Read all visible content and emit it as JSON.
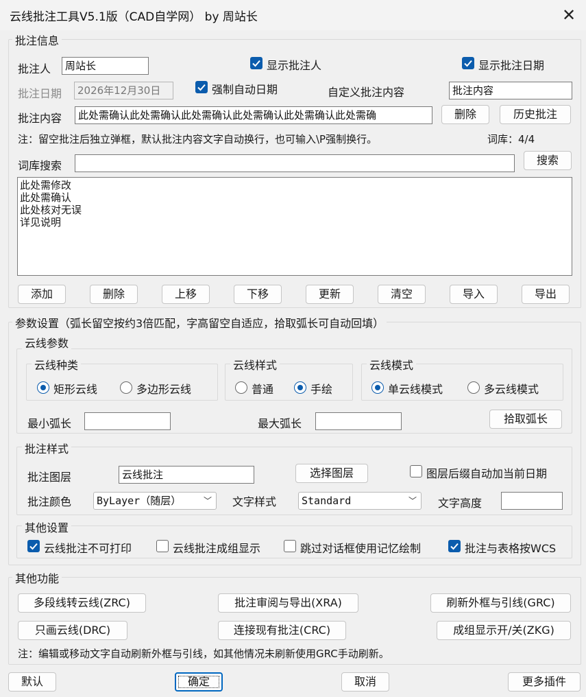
{
  "window": {
    "title": "云线批注工具V5.1版（CAD自学网） by 周站长",
    "close_glyph": "✕"
  },
  "annotation_info": {
    "legend": "批注信息",
    "annotator_label": "批注人",
    "annotator_value": "周站长",
    "show_annotator": "显示批注人",
    "show_date": "显示批注日期",
    "date_label": "批注日期",
    "date_value": "2026年12月30日",
    "force_auto_date": "强制自动日期",
    "custom_label": "自定义批注内容",
    "custom_value": "批注内容",
    "content_label": "批注内容",
    "content_value": "此处需确认此处需确认此处需确认此处需确认此处需确认此处需确",
    "delete_btn": "删除",
    "history_btn": "历史批注",
    "note": "注：留空批注后独立弹框，默认批注内容文字自动换行，也可输入\\P强制换行。",
    "lib_count": "词库：4/4",
    "search_label": "词库搜索",
    "search_value": "",
    "search_btn": "搜索",
    "library_items": [
      "此处需修改",
      "此处需确认",
      "此处核对无误",
      "详见说明"
    ],
    "list_buttons": [
      "添加",
      "删除",
      "上移",
      "下移",
      "更新",
      "清空",
      "导入",
      "导出"
    ]
  },
  "params": {
    "legend": "参数设置（弧长留空按约3倍匹配，字高留空自适应，拾取弧长可自动回填）",
    "cloud": {
      "legend": "云线参数",
      "kind_legend": "云线种类",
      "kind_options": [
        "矩形云线",
        "多边形云线"
      ],
      "style_legend": "云线样式",
      "style_options": [
        "普通",
        "手绘"
      ],
      "mode_legend": "云线模式",
      "mode_options": [
        "单云线模式",
        "多云线模式"
      ],
      "min_arc_label": "最小弧长",
      "min_arc_value": "",
      "max_arc_label": "最大弧长",
      "max_arc_value": "",
      "pick_arc_btn": "拾取弧长"
    },
    "style": {
      "legend": "批注样式",
      "layer_label": "批注图层",
      "layer_value": "云线批注",
      "select_layer_btn": "选择图层",
      "layer_suffix_date": "图层后缀自动加当前日期",
      "color_label": "批注颜色",
      "color_value": "ByLayer（随层）",
      "text_style_label": "文字样式",
      "text_style_value": "Standard",
      "text_height_label": "文字高度",
      "text_height_value": ""
    },
    "other": {
      "legend": "其他设置",
      "options": [
        "云线批注不可打印",
        "云线批注成组显示",
        "跳过对话框使用记忆绘制",
        "批注与表格按WCS"
      ]
    }
  },
  "functions": {
    "legend": "其他功能",
    "buttons": [
      "多段线转云线(ZRC)",
      "批注审阅与导出(XRA)",
      "刷新外框与引线(GRC)",
      "只画云线(DRC)",
      "连接现有批注(CRC)",
      "成组显示开/关(ZKG)"
    ],
    "note": "注：编辑或移动文字自动刷新外框与引线，如其他情况未刷新使用GRC手动刷新。"
  },
  "footer": {
    "default_btn": "默认",
    "ok_btn": "确定",
    "cancel_btn": "取消",
    "more_btn": "更多插件"
  }
}
